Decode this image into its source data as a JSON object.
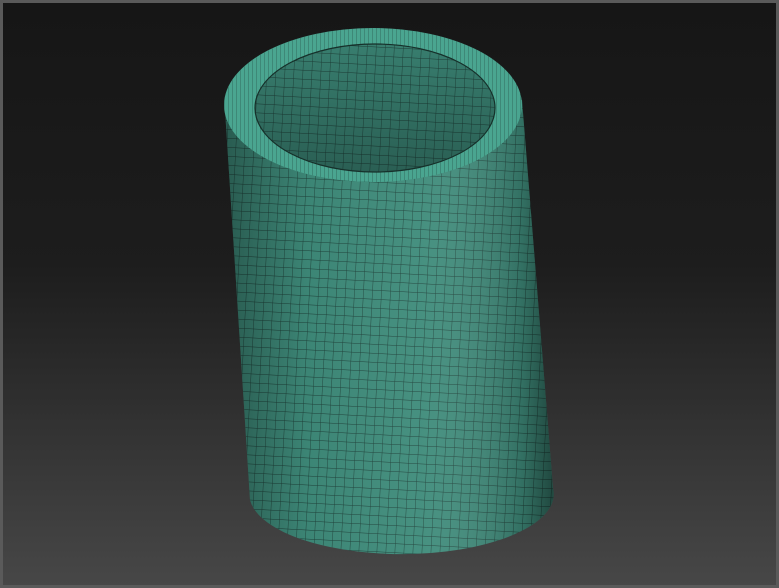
{
  "viewport": {
    "background_top": "#161616",
    "background_bottom": "#474747",
    "frame_color": "#5a5a5a"
  },
  "model": {
    "name": "cylinder-tube-mesh",
    "surface_color": "#3f8c7b",
    "rim_color": "#4aa590",
    "wire_color": "#16302a"
  }
}
